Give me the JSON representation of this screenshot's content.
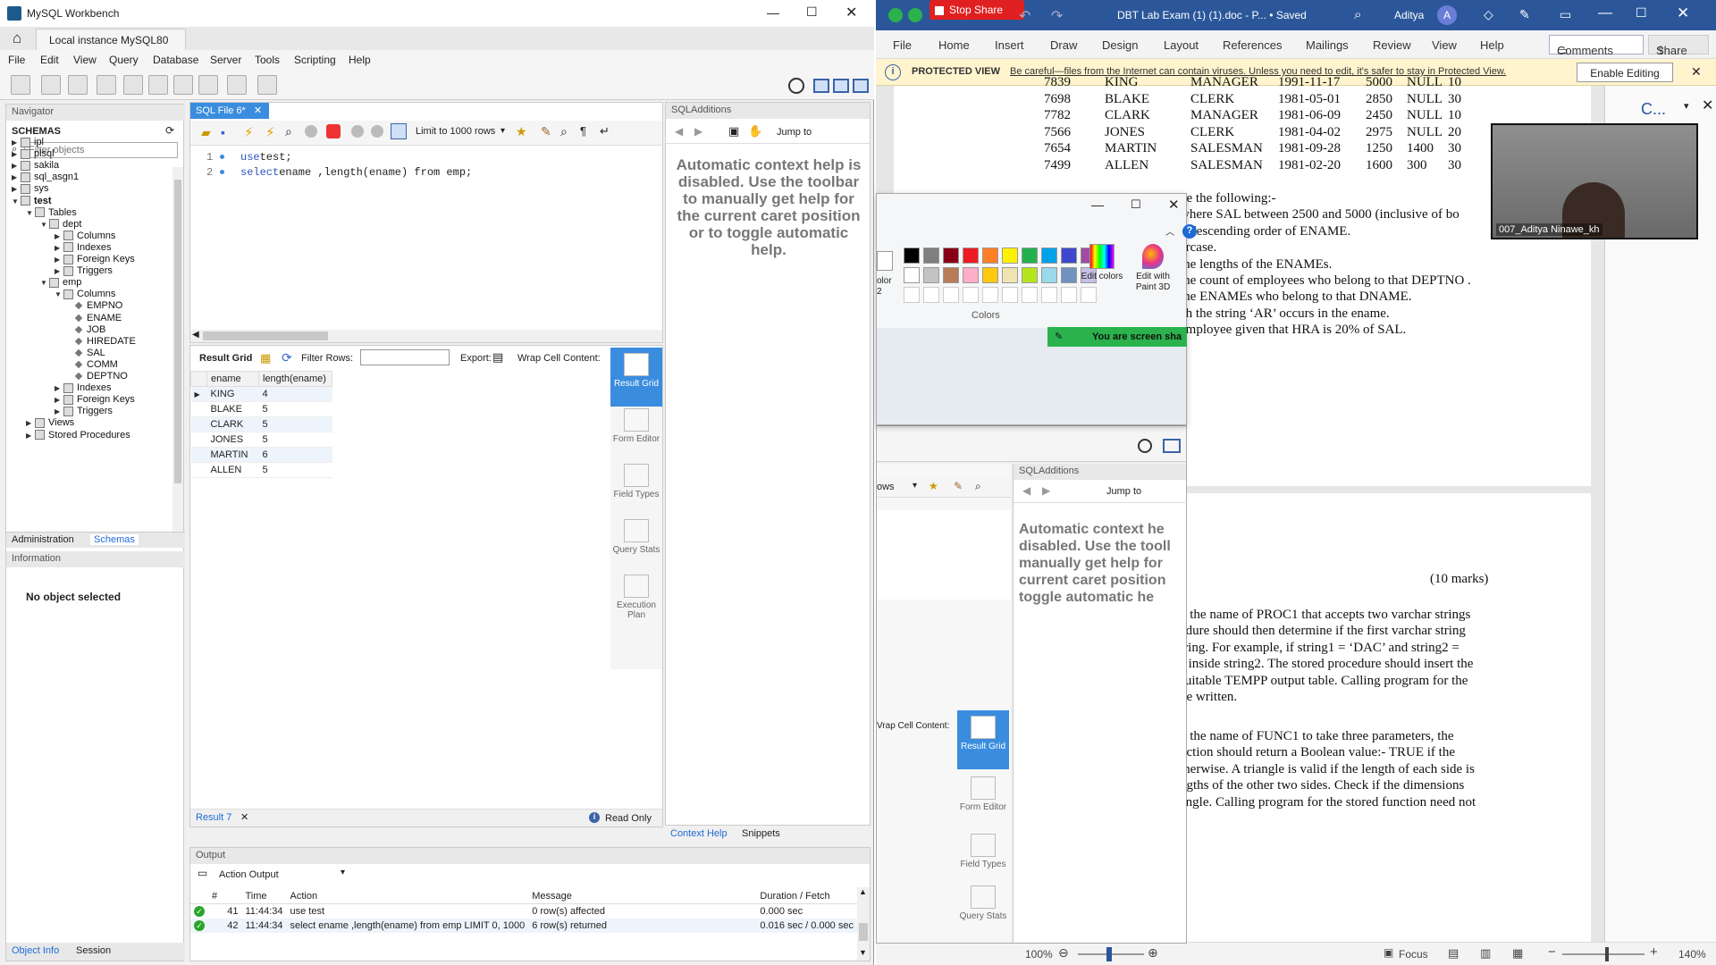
{
  "workbench": {
    "title": "MySQL Workbench",
    "instance_tab": "Local instance MySQL80",
    "menu": [
      "File",
      "Edit",
      "View",
      "Query",
      "Database",
      "Server",
      "Tools",
      "Scripting",
      "Help"
    ],
    "navigator": {
      "header": "Navigator",
      "schemas_label": "SCHEMAS",
      "filter_placeholder": "Filter objects",
      "tree": [
        {
          "label": "ipl",
          "level": 0,
          "kind": "db",
          "bold": false
        },
        {
          "label": "plsql",
          "level": 0,
          "kind": "db",
          "bold": false
        },
        {
          "label": "sakila",
          "level": 0,
          "kind": "db",
          "bold": false
        },
        {
          "label": "sql_asgn1",
          "level": 0,
          "kind": "db",
          "bold": false
        },
        {
          "label": "sys",
          "level": 0,
          "kind": "db",
          "bold": false
        },
        {
          "label": "test",
          "level": 0,
          "kind": "db",
          "bold": true
        },
        {
          "label": "Tables",
          "level": 1,
          "kind": "folder",
          "bold": false
        },
        {
          "label": "dept",
          "level": 2,
          "kind": "table",
          "bold": false
        },
        {
          "label": "Columns",
          "level": 3,
          "kind": "folder",
          "bold": false
        },
        {
          "label": "Indexes",
          "level": 3,
          "kind": "folder",
          "bold": false
        },
        {
          "label": "Foreign Keys",
          "level": 3,
          "kind": "folder",
          "bold": false
        },
        {
          "label": "Triggers",
          "level": 3,
          "kind": "folder",
          "bold": false
        },
        {
          "label": "emp",
          "level": 2,
          "kind": "table",
          "bold": false
        },
        {
          "label": "Columns",
          "level": 3,
          "kind": "folder",
          "bold": false
        },
        {
          "label": "EMPNO",
          "level": 4,
          "kind": "col",
          "bold": false
        },
        {
          "label": "ENAME",
          "level": 4,
          "kind": "col",
          "bold": false
        },
        {
          "label": "JOB",
          "level": 4,
          "kind": "col",
          "bold": false
        },
        {
          "label": "HIREDATE",
          "level": 4,
          "kind": "col",
          "bold": false
        },
        {
          "label": "SAL",
          "level": 4,
          "kind": "col",
          "bold": false
        },
        {
          "label": "COMM",
          "level": 4,
          "kind": "col",
          "bold": false
        },
        {
          "label": "DEPTNO",
          "level": 4,
          "kind": "col",
          "bold": false
        },
        {
          "label": "Indexes",
          "level": 3,
          "kind": "folder",
          "bold": false
        },
        {
          "label": "Foreign Keys",
          "level": 3,
          "kind": "folder",
          "bold": false
        },
        {
          "label": "Triggers",
          "level": 3,
          "kind": "folder",
          "bold": false
        },
        {
          "label": "Views",
          "level": 1,
          "kind": "folder",
          "bold": false
        },
        {
          "label": "Stored Procedures",
          "level": 1,
          "kind": "folder",
          "bold": false
        }
      ],
      "tabs": {
        "administration": "Administration",
        "schemas": "Schemas"
      },
      "info_header": "Information",
      "no_object": "No object selected",
      "bottom_tabs": {
        "object_info": "Object Info",
        "session": "Session"
      }
    },
    "editor": {
      "tab_label": "SQL File 6*",
      "limit_label": "Limit to 1000 rows",
      "jump_to": "Jump to",
      "lines": [
        {
          "num": "1",
          "kw": "use",
          "rest": " test;"
        },
        {
          "num": "2",
          "kw": "select",
          "rest": " ename ,length(ename) from emp;"
        }
      ]
    },
    "results": {
      "toolbar": {
        "result_grid": "Result Grid",
        "filter_rows": "Filter Rows:",
        "export": "Export:",
        "wrap": "Wrap Cell Content:"
      },
      "columns": [
        "ename",
        "length(ename)"
      ],
      "rows": [
        [
          "KING",
          "4"
        ],
        [
          "BLAKE",
          "5"
        ],
        [
          "CLARK",
          "5"
        ],
        [
          "JONES",
          "5"
        ],
        [
          "MARTIN",
          "6"
        ],
        [
          "ALLEN",
          "5"
        ]
      ],
      "side_buttons": [
        "Result Grid",
        "Form Editor",
        "Field Types",
        "Query Stats",
        "Execution Plan"
      ],
      "tab": "Result 7",
      "read_only": "Read Only"
    },
    "sql_additions": {
      "header": "SQLAdditions",
      "help_text": "Automatic context help is disabled. Use the toolbar to manually get help for the current caret position or to toggle automatic help.",
      "bottom_tabs": {
        "context_help": "Context Help",
        "snippets": "Snippets"
      }
    },
    "output": {
      "header": "Output",
      "selector": "Action Output",
      "columns": [
        "#",
        "Time",
        "Action",
        "Message",
        "Duration / Fetch"
      ],
      "rows": [
        {
          "num": "41",
          "time": "11:44:34",
          "action": "use test",
          "message": "0 row(s) affected",
          "duration": "0.000 sec"
        },
        {
          "num": "42",
          "time": "11:44:34",
          "action": "select ename ,length(ename) from emp LIMIT 0, 1000",
          "message": "6 row(s) returned",
          "duration": "0.016 sec / 0.000 sec"
        }
      ]
    }
  },
  "word": {
    "stop_share": "Stop Share",
    "title": "DBT Lab Exam (1) (1).doc - P... • Saved",
    "user": "Aditya",
    "avatar": "A",
    "menu": [
      "File",
      "Home",
      "Insert",
      "Draw",
      "Design",
      "Layout",
      "References",
      "Mailings",
      "Review",
      "View",
      "Help"
    ],
    "comments": "Comments",
    "share": "Share",
    "protected_label": "PROTECTED VIEW",
    "protected_msg": "Be careful—files from the Internet can contain viruses. Unless you need to edit, it's safer to stay in Protected View.",
    "enable_editing": "Enable Editing",
    "table_rows": [
      [
        "7839",
        "KING",
        "MANAGER",
        "1991-11-17",
        "5000",
        "NULL",
        "10"
      ],
      [
        "7698",
        "BLAKE",
        "CLERK",
        "1981-05-01",
        "2850",
        "NULL",
        "30"
      ],
      [
        "7782",
        "CLARK",
        "MANAGER",
        "1981-06-09",
        "2450",
        "NULL",
        "10"
      ],
      [
        "7566",
        "JONES",
        "CLERK",
        "1981-04-02",
        "2975",
        "NULL",
        "20"
      ],
      [
        "7654",
        "MARTIN",
        "SALESMAN",
        "1981-09-28",
        "1250",
        "1400",
        "30"
      ],
      [
        "7499",
        "ALLEN",
        "SALESMAN",
        "1981-02-20",
        "1600",
        "300",
        "30"
      ]
    ],
    "questions": [
      "ve the following:-",
      "where SAL between 2500 and 5000 (inclusive of bo",
      "n descending order of ENAME.",
      "ercase.",
      "the lengths of the ENAMEs.",
      "the count of employees who belong to that DEPTNO .",
      "the ENAMEs who belong to that DNAME.",
      "ch the string ‘AR’ occurs in the ename.",
      "employee given that HRA is 20% of SAL."
    ],
    "marks": "(10 marks)",
    "para1": [
      "y the name of PROC1 that accepts two varchar strings",
      "edure should then determine if the first varchar string",
      "tring. For example, if string1 = ‘DAC’ and string2 =",
      "s inside string2.  The stored procedure should insert the",
      " suitable TEMPP output table. Calling program for the",
      "be written."
    ],
    "para2": [
      "y the name of FUNC1 to take three parameters, the",
      "nction should return a Boolean value:- TRUE if the",
      "therwise. A triangle is valid if the length of each side is",
      "ngths of the other two sides. Check if the dimensions",
      "angle. Calling program for the stored function need not"
    ],
    "zoom": "100%",
    "focus": "Focus",
    "zoom_right": "140%",
    "pane_label": "C..."
  },
  "paint": {
    "colors_label": "Colors",
    "edit_colors": "Edit colors",
    "edit_paint3d": "Edit with Paint 3D",
    "color_label": "olor 2",
    "palette": [
      "#000000",
      "#7f7f7f",
      "#880015",
      "#ed1c24",
      "#ff7f27",
      "#fff200",
      "#22b14c",
      "#00a2e8",
      "#3f48cc",
      "#a349a4",
      "#ffffff",
      "#c3c3c3",
      "#b97a57",
      "#ffaec9",
      "#ffc90e",
      "#efe4b0",
      "#b5e61d",
      "#99d9ea",
      "#7092be",
      "#c8bfe7"
    ],
    "share_banner": "You are screen sha"
  },
  "ghost": {
    "sql_additions": "SQLAdditions",
    "jump_to": "Jump to",
    "rows_label": "ows",
    "help_text": "Automatic context he disabled. Use the tooll manually get help for current caret position toggle automatic he",
    "wrap": "Vrap Cell Content:",
    "side_buttons": [
      "Result Grid",
      "Form Editor",
      "Field Types",
      "Query Stats"
    ]
  },
  "camera": {
    "name": "007_Aditya Ninawe_kh"
  }
}
